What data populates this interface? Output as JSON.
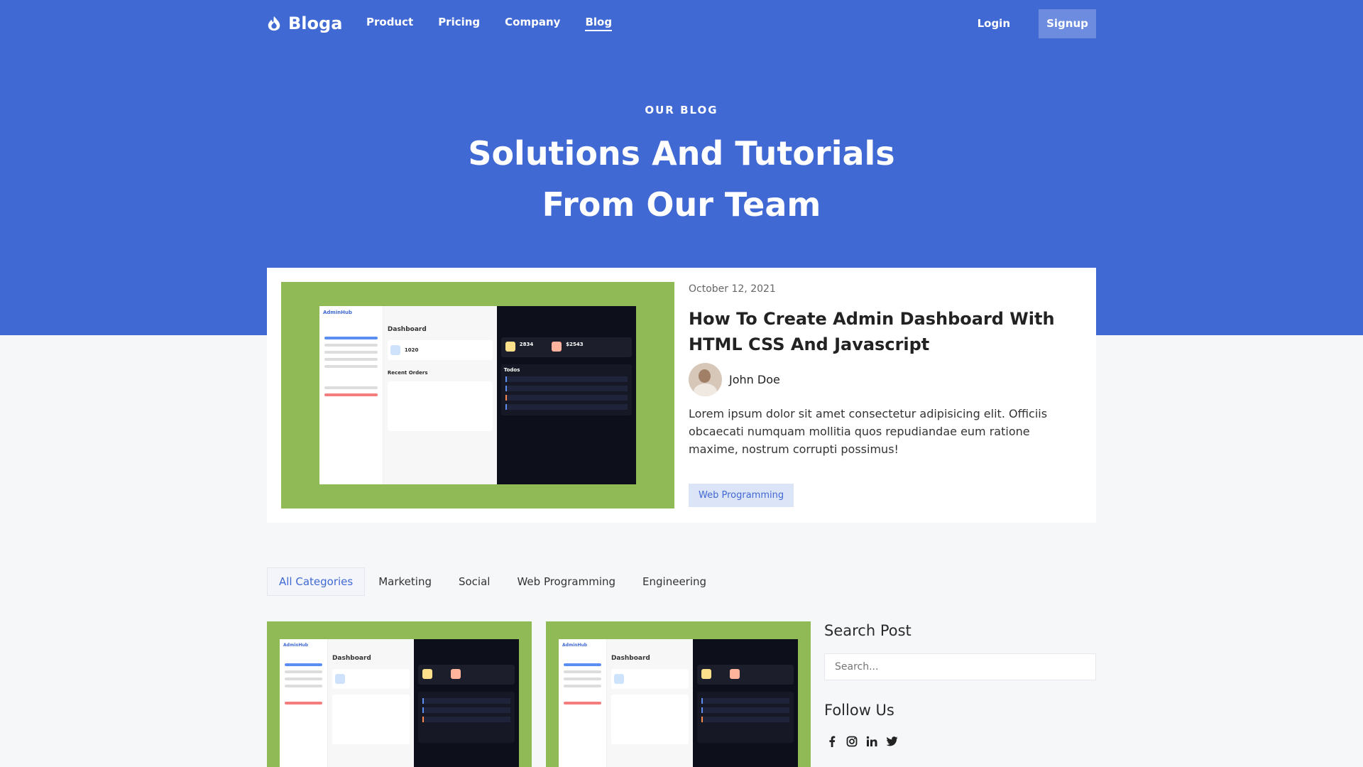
{
  "brand": {
    "name": "Bloga"
  },
  "nav": {
    "items": [
      {
        "label": "Product"
      },
      {
        "label": "Pricing"
      },
      {
        "label": "Company"
      },
      {
        "label": "Blog"
      }
    ],
    "login": "Login",
    "signup": "Signup"
  },
  "hero": {
    "eyebrow": "OUR BLOG",
    "title_line1": "Solutions And Tutorials",
    "title_line2": "From Our Team"
  },
  "featured": {
    "date": "October 12, 2021",
    "title": "How To Create Admin Dashboard With HTML CSS And Javascript",
    "author": "John Doe",
    "excerpt": "Lorem ipsum dolor sit amet consectetur adipisicing elit. Officiis obcaecati numquam mollitia quos repudiandae eum ratione maxime, nostrum corrupti possimus!",
    "tag": "Web Programming",
    "image": {
      "app": "AdminHub",
      "heading": "Dashboard",
      "stats": [
        "1020",
        "2834",
        "$2543"
      ],
      "recent": "Recent Orders",
      "todos": "Todos"
    }
  },
  "categories": [
    "All Categories",
    "Marketing",
    "Social",
    "Web Programming",
    "Engineering"
  ],
  "sidebar": {
    "search_title": "Search Post",
    "search_placeholder": "Search...",
    "follow_title": "Follow Us",
    "social": [
      "facebook-icon",
      "instagram-icon",
      "linkedin-icon",
      "twitter-icon"
    ]
  },
  "colors": {
    "primary": "#4169d3",
    "image_bg": "#8fba55",
    "tag_bg": "#dce4f8"
  }
}
